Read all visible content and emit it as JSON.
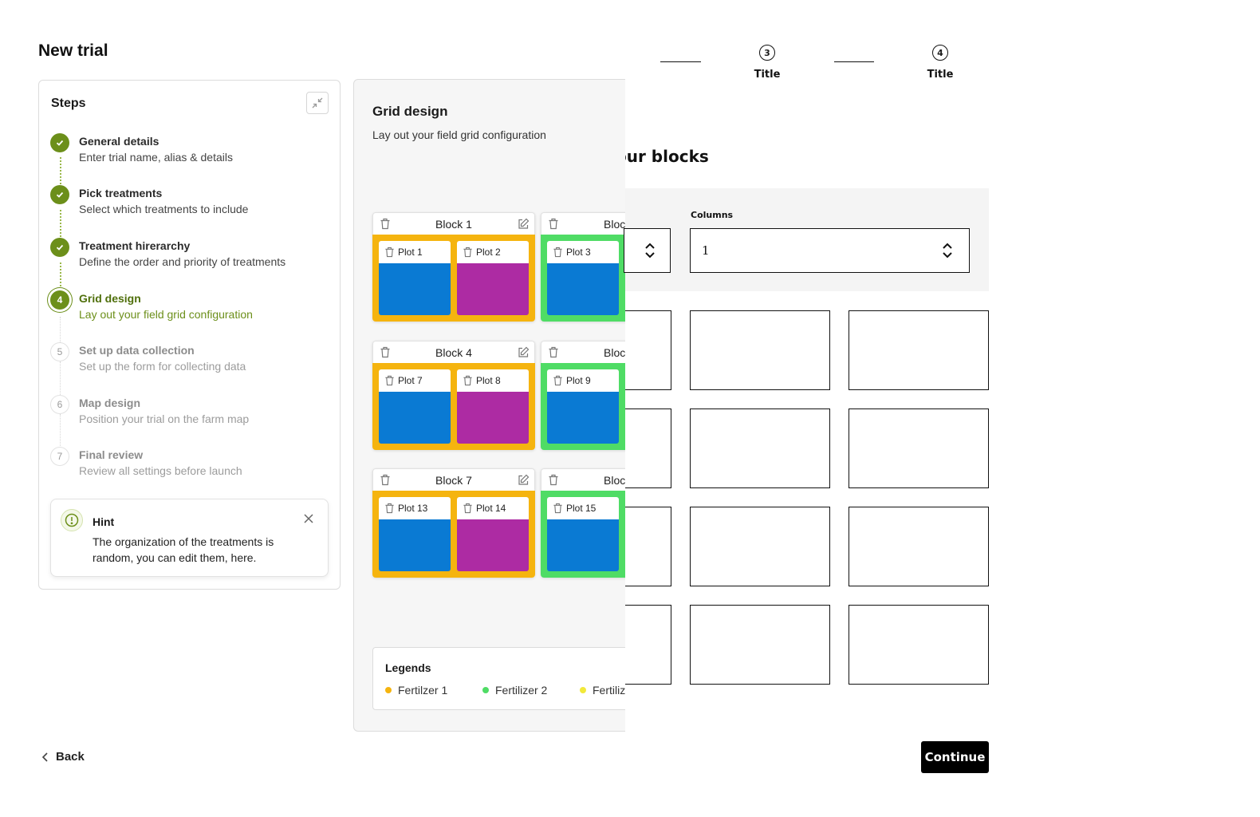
{
  "page": {
    "title": "New trial"
  },
  "steps_panel": {
    "title": "Steps",
    "steps": [
      {
        "number": "1",
        "title": "General details",
        "desc": "Enter trial name, alias & details",
        "status": "done"
      },
      {
        "number": "2",
        "title": "Pick treatments",
        "desc": "Select which treatments to include",
        "status": "done"
      },
      {
        "number": "3",
        "title": "Treatment hirerarchy",
        "desc": "Define the order and priority of treatments",
        "status": "done"
      },
      {
        "number": "4",
        "title": "Grid design",
        "desc": "Lay out your field grid configuration",
        "status": "current"
      },
      {
        "number": "5",
        "title": "Set up data collection",
        "desc": "Set up the form for collecting data",
        "status": "pending"
      },
      {
        "number": "6",
        "title": "Map design",
        "desc": "Position your trial on the farm map",
        "status": "pending"
      },
      {
        "number": "7",
        "title": "Final review",
        "desc": "Review all settings before launch",
        "status": "pending"
      }
    ],
    "hint": {
      "title": "Hint",
      "text": "The organization of the treatments is random, you can edit them, here."
    }
  },
  "grid_panel": {
    "title": "Grid design",
    "subtitle": "Lay out your field grid configuration",
    "blocks": [
      {
        "name": "Block 1",
        "plots": [
          "Plot 1",
          "Plot 2"
        ]
      },
      {
        "name": "Bloc",
        "plots": [
          "Plot 3"
        ]
      },
      {
        "name": "Block 4",
        "plots": [
          "Plot 7",
          "Plot 8"
        ]
      },
      {
        "name": "Bloc",
        "plots": [
          "Plot 9"
        ]
      },
      {
        "name": "Block 7",
        "plots": [
          "Plot 13",
          "Plot 14"
        ]
      },
      {
        "name": "Bloc",
        "plots": [
          "Plot 15"
        ]
      }
    ],
    "legend": {
      "title": "Legends",
      "items": [
        {
          "label": "Fertilzer 1",
          "color": "#f5b40f"
        },
        {
          "label": "Fertilizer 2",
          "color": "#4fdc65"
        },
        {
          "label": "Fertiliz",
          "color": "#f2e93a"
        }
      ]
    }
  },
  "colors": {
    "accent": "#6c8f1a",
    "block_orange": "#f5b40f",
    "block_green": "#4fdc65",
    "plot_blue": "#0a7ad3",
    "plot_purple": "#ad2ba3"
  },
  "wireframe": {
    "stepper": [
      {
        "number": "3",
        "label": "Title"
      },
      {
        "number": "4",
        "label": "Title"
      }
    ],
    "heading": "our blocks",
    "columns_label": "Columns",
    "columns_value": "1",
    "continue_label": "Continue"
  },
  "footer": {
    "back_label": "Back"
  }
}
